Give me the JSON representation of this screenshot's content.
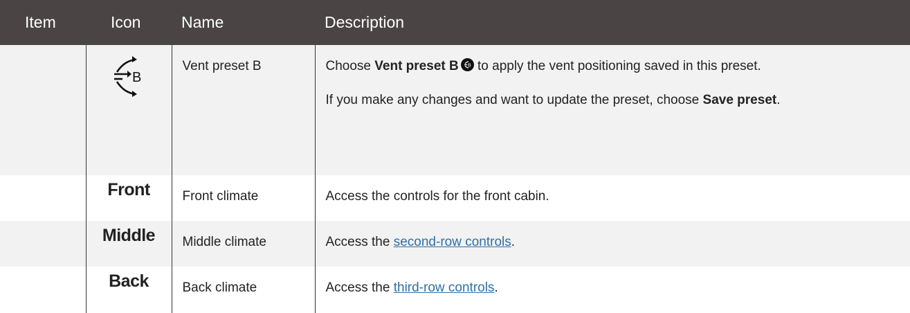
{
  "table": {
    "headers": {
      "item": "Item",
      "icon": "Icon",
      "name": "Name",
      "description": "Description"
    },
    "rows": [
      {
        "item": "",
        "icon_name": "vent-preset-b-icon",
        "icon_letter": "B",
        "name": "Vent preset B",
        "desc_p1_pre": "Choose ",
        "desc_p1_bold": "Vent preset B",
        "desc_p1_post": " to apply the vent positioning saved in this preset.",
        "desc_p2_pre": "If you make any changes and want to update the preset, choose ",
        "desc_p2_bold": "Save preset",
        "desc_p2_post": "."
      },
      {
        "item": "",
        "icon_text": "Front",
        "name": "Front climate",
        "desc": "Access the controls for the front cabin."
      },
      {
        "item": "",
        "icon_text": "Middle",
        "name": "Middle climate",
        "desc_pre": "Access the ",
        "desc_link": "second-row controls",
        "desc_post": "."
      },
      {
        "item": "",
        "icon_text": "Back",
        "name": "Back climate",
        "desc_pre": "Access the ",
        "desc_link": "third-row controls",
        "desc_post": "."
      }
    ]
  },
  "colors": {
    "header_bg": "#4a4544",
    "shade_bg": "#f2f2f2",
    "link": "#2f6fa7"
  }
}
